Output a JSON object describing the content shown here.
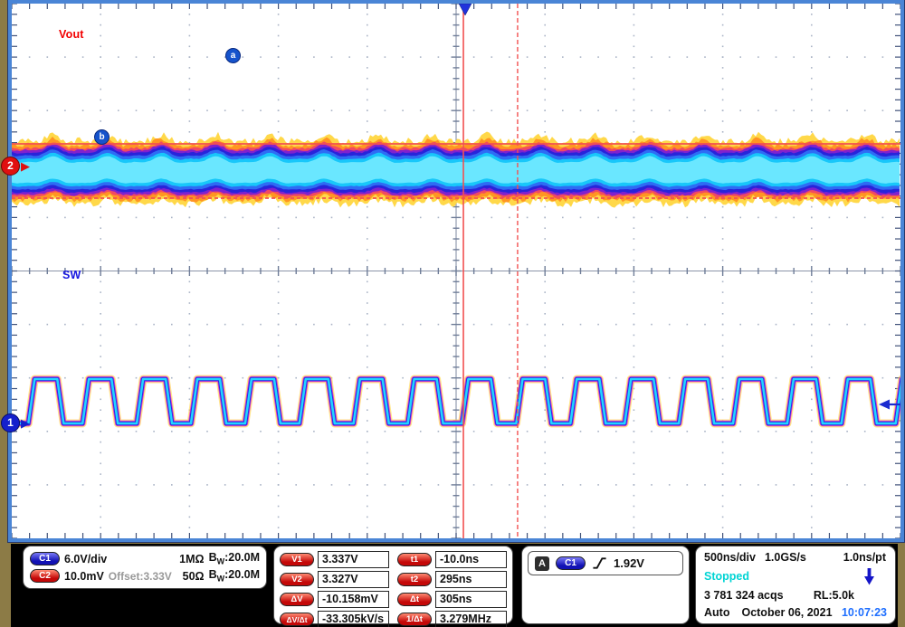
{
  "screen": {
    "ch2_trace_label": "Vout",
    "ch1_trace_label": "SW",
    "cursor_a": "a",
    "cursor_b": "b",
    "ch1_marker": "1",
    "ch2_marker": "2",
    "colors": {
      "ch1_accent": "#1520cc",
      "ch2_accent": "#e01010",
      "cursor_red": "#f25151",
      "stopped_cyan": "#00d4d4",
      "clock_blue": "#1f6fff",
      "frame_blue": "#4a85d6",
      "bezel_olive": "#8c7b46"
    }
  },
  "channels_panel": {
    "rows": [
      {
        "badge": "C1",
        "scale": "6.0V/div",
        "offset": "",
        "impedance": "1MΩ",
        "bw_b": "B",
        "bw_sub": "W",
        "bw_val": ":20.0M"
      },
      {
        "badge": "C2",
        "scale": "10.0mV",
        "offset": "Offset:3.33V",
        "impedance": "50Ω",
        "bw_b": "B",
        "bw_sub": "W",
        "bw_val": ":20.0M"
      }
    ]
  },
  "measure_panel": {
    "voltage": [
      {
        "label": "V1",
        "value": "3.337V"
      },
      {
        "label": "V2",
        "value": "3.327V"
      },
      {
        "label": "ΔV",
        "value": "-10.158mV"
      },
      {
        "label": "ΔV/Δt",
        "value": "-33.305kV/s"
      }
    ],
    "time": [
      {
        "label": "t1",
        "value": "-10.0ns"
      },
      {
        "label": "t2",
        "value": "295ns"
      },
      {
        "label": "Δt",
        "value": "305ns"
      },
      {
        "label": "1/Δt",
        "value": "3.279MHz"
      }
    ]
  },
  "trigger_panel": {
    "bus": "A",
    "source": "C1",
    "slope": "rising",
    "level": "1.92V"
  },
  "horizontal_panel": {
    "timebase": "500ns/div",
    "sample_rate": "1.0GS/s",
    "resolution": "1.0ns/pt",
    "status": "Stopped",
    "acquisitions": "3 781 324 acqs",
    "record_length": "RL:5.0k",
    "mode": "Auto",
    "date": "October 06, 2021",
    "clock": "10:07:23"
  },
  "chart_data": {
    "type": "oscilloscope",
    "horizontal_divisions": 10,
    "vertical_divisions": 10,
    "timebase_ns_per_div": 500,
    "channels": [
      {
        "name": "SW",
        "source": "C1",
        "scale": "6.0V/div",
        "shape": "trapezoidal_square_wave",
        "period_ns": 305,
        "frequency_MHz": 3.279,
        "duty_cycle_high": 0.55,
        "low_level_V": 0.0,
        "high_level_V": 5.0
      },
      {
        "name": "Vout",
        "source": "C2",
        "scale": "10.0mV/div",
        "offset_V": 3.33,
        "shape": "noisy_ripple_band",
        "mean_V": 3.332,
        "ripple_Vpp_mV": 10.158,
        "ripple_period_ns": 305
      }
    ],
    "cursors": {
      "t1_ns": -10.0,
      "t2_ns": 295,
      "dt_ns": 305,
      "one_over_dt_MHz": 3.279,
      "v1_V": 3.337,
      "v2_V": 3.327,
      "dv_mV": -10.158,
      "dv_dt_kV_per_s": -33.305
    },
    "trigger": {
      "source": "C1",
      "slope": "rising",
      "level_V": 1.92
    }
  }
}
